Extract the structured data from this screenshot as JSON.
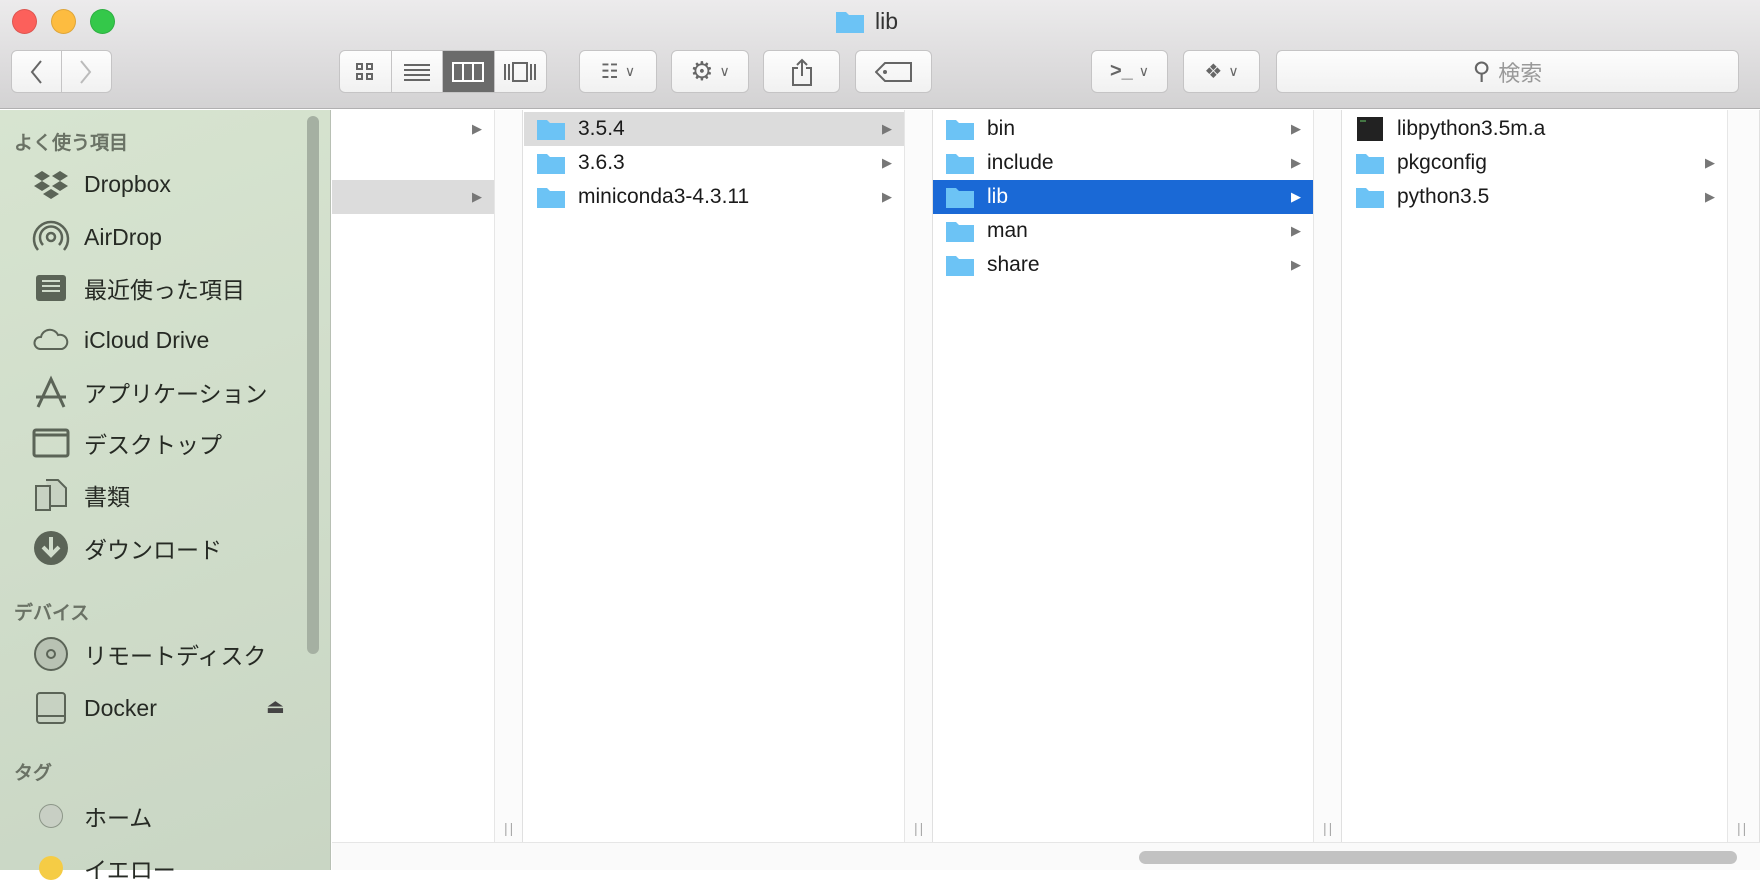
{
  "window": {
    "title": "lib"
  },
  "toolbar": {
    "back": "back",
    "forward": "forward",
    "search_placeholder": "検索"
  },
  "sidebar": {
    "sections": [
      {
        "header": "よく使う項目",
        "items": [
          {
            "label": "Dropbox",
            "icon": "dropbox-icon"
          },
          {
            "label": "AirDrop",
            "icon": "airdrop-icon"
          },
          {
            "label": "最近使った項目",
            "icon": "recents-icon"
          },
          {
            "label": "iCloud Drive",
            "icon": "cloud-icon"
          },
          {
            "label": "アプリケーション",
            "icon": "applications-icon"
          },
          {
            "label": "デスクトップ",
            "icon": "desktop-icon"
          },
          {
            "label": "書類",
            "icon": "documents-icon"
          },
          {
            "label": "ダウンロード",
            "icon": "download-icon"
          }
        ]
      },
      {
        "header": "デバイス",
        "items": [
          {
            "label": "リモートディスク",
            "icon": "disc-icon"
          },
          {
            "label": "Docker",
            "icon": "drive-icon"
          }
        ]
      },
      {
        "header": "タグ",
        "items": [
          {
            "label": "ホーム",
            "color": "#c8cfc4"
          },
          {
            "label": "イエロー",
            "color": "#f5cc45"
          }
        ]
      }
    ]
  },
  "columns": [
    {
      "items": [
        {
          "label": "",
          "folder": false,
          "arrow": true
        },
        {
          "label": "",
          "folder": false,
          "arrow": false
        },
        {
          "label": "",
          "folder": false,
          "arrow": true,
          "selected": true
        }
      ]
    },
    {
      "items": [
        {
          "label": "3.5.4",
          "arrow": true,
          "selected": true
        },
        {
          "label": "3.6.3",
          "arrow": true
        },
        {
          "label": "miniconda3-4.3.11",
          "arrow": true
        }
      ]
    },
    {
      "items": [
        {
          "label": "bin",
          "arrow": true
        },
        {
          "label": "include",
          "arrow": true
        },
        {
          "label": "lib",
          "arrow": true,
          "active": true
        },
        {
          "label": "man",
          "arrow": true
        },
        {
          "label": "share",
          "arrow": true
        }
      ]
    },
    {
      "items": [
        {
          "label": "libpython3.5m.a",
          "arrow": false,
          "file": true
        },
        {
          "label": "pkgconfig",
          "arrow": true
        },
        {
          "label": "python3.5",
          "arrow": true
        }
      ]
    }
  ]
}
